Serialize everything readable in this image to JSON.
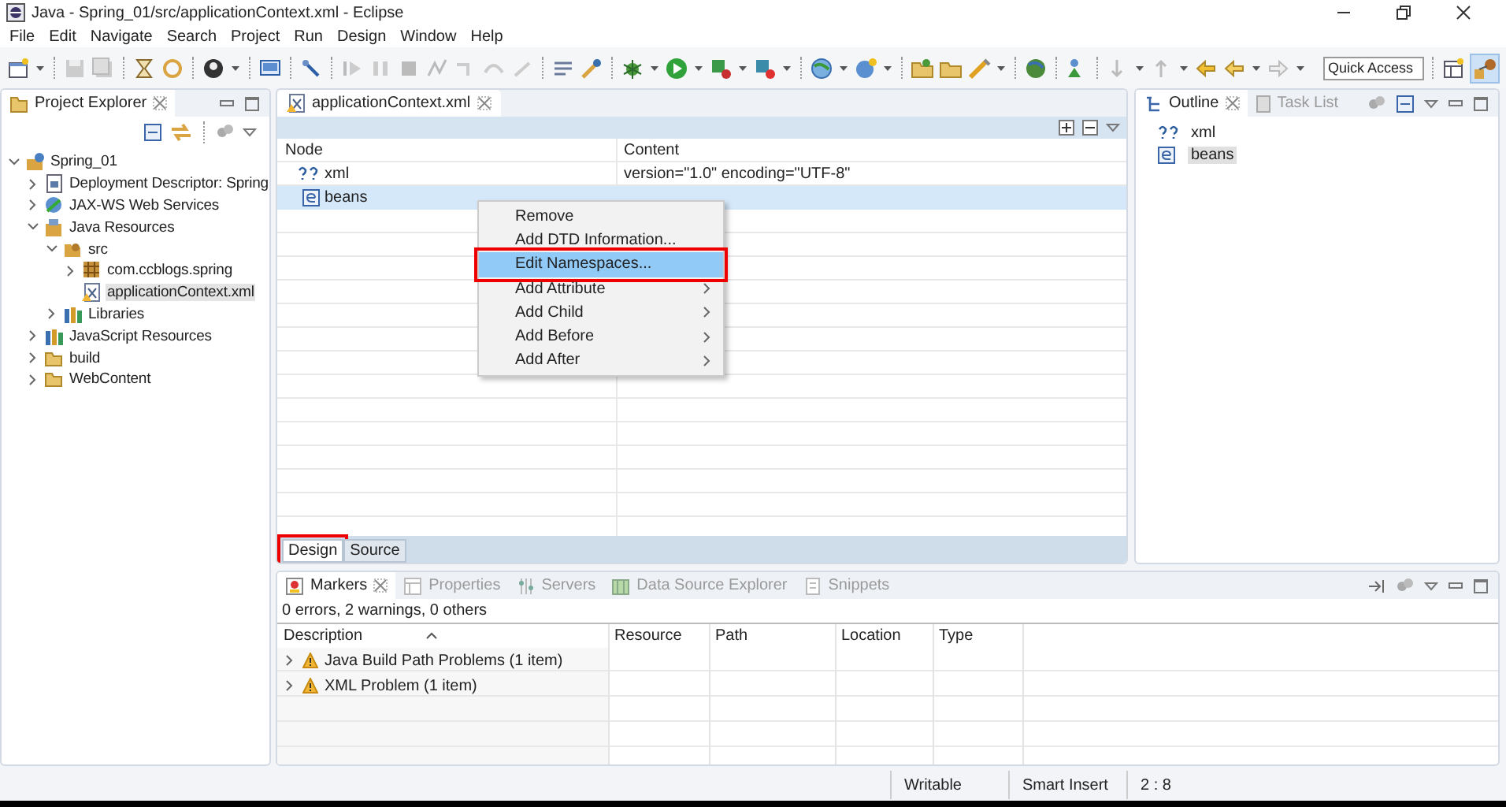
{
  "window": {
    "title": "Java - Spring_01/src/applicationContext.xml - Eclipse"
  },
  "menu": [
    "File",
    "Edit",
    "Navigate",
    "Search",
    "Project",
    "Run",
    "Design",
    "Window",
    "Help"
  ],
  "quick_access": {
    "placeholder": "Quick Access"
  },
  "project_explorer": {
    "title": "Project Explorer",
    "tree": [
      {
        "label": "Spring_01",
        "kind": "project",
        "expanded": true,
        "selected": false,
        "children": [
          {
            "label": "Deployment Descriptor: Spring",
            "kind": "descriptor",
            "expanded": false,
            "selected": false
          },
          {
            "label": "JAX-WS Web Services",
            "kind": "services",
            "expanded": false,
            "selected": false
          },
          {
            "label": "Java Resources",
            "kind": "resources",
            "expanded": true,
            "selected": false,
            "children": [
              {
                "label": "src",
                "kind": "source",
                "expanded": true,
                "selected": false,
                "children": [
                  {
                    "label": "com.ccblogs.spring",
                    "kind": "package",
                    "expanded": false,
                    "selected": false
                  },
                  {
                    "label": "applicationContext.xml",
                    "kind": "file",
                    "selected": true
                  }
                ]
              },
              {
                "label": "Libraries",
                "kind": "library",
                "expanded": false,
                "selected": false
              }
            ]
          },
          {
            "label": "JavaScript Resources",
            "kind": "library",
            "expanded": false,
            "selected": false
          },
          {
            "label": "build",
            "kind": "folder",
            "expanded": false,
            "selected": false
          },
          {
            "label": "WebContent",
            "kind": "folder",
            "expanded": false,
            "selected": false
          }
        ]
      }
    ]
  },
  "editor": {
    "tab": {
      "label": "applicationContext.xml",
      "selected": true
    },
    "columns": [
      "Node",
      "Content"
    ],
    "rows": [
      {
        "node": "xml",
        "kind": "declaration",
        "content": "version=\"1.0\" encoding=\"UTF-8\"",
        "selected": false
      },
      {
        "node": "beans",
        "kind": "element",
        "selected": true
      }
    ],
    "context_menu": [
      {
        "label": "Remove",
        "submenu": false,
        "selected": false,
        "annotated": false
      },
      {
        "label": "Add DTD Information...",
        "submenu": false,
        "selected": false,
        "annotated": false
      },
      {
        "label": "Edit Namespaces...",
        "submenu": false,
        "selected": true,
        "annotated": true
      },
      {
        "label": "Add Attribute",
        "submenu": true,
        "selected": false,
        "annotated": false
      },
      {
        "label": "Add Child",
        "submenu": true,
        "selected": false,
        "annotated": false
      },
      {
        "label": "Add Before",
        "submenu": true,
        "selected": false,
        "annotated": false
      },
      {
        "label": "Add After",
        "submenu": true,
        "selected": false,
        "annotated": false
      }
    ],
    "bottom_tabs": [
      {
        "label": "Design",
        "selected": true,
        "annotated": true
      },
      {
        "label": "Source",
        "selected": false,
        "annotated": false
      }
    ]
  },
  "outline": {
    "tabs": [
      {
        "label": "Outline",
        "selected": true
      },
      {
        "label": "Task List",
        "selected": false
      }
    ],
    "items": [
      {
        "label": "xml",
        "kind": "declaration",
        "selected": false
      },
      {
        "label": "beans",
        "kind": "element",
        "selected": true
      }
    ]
  },
  "markers": {
    "tabs": [
      {
        "label": "Markers",
        "selected": true
      },
      {
        "label": "Properties",
        "selected": false
      },
      {
        "label": "Servers",
        "selected": false
      },
      {
        "label": "Data Source Explorer",
        "selected": false
      },
      {
        "label": "Snippets",
        "selected": false
      }
    ],
    "summary": "0 errors, 2 warnings, 0 others",
    "columns": [
      "Description",
      "Resource",
      "Path",
      "Location",
      "Type"
    ],
    "rows": [
      {
        "description": "Java Build Path Problems (1 item)",
        "expanded": false
      },
      {
        "description": "XML Problem (1 item)",
        "expanded": false
      }
    ]
  },
  "status_bar": [
    "Writable",
    "Smart Insert",
    "2 : 8"
  ]
}
